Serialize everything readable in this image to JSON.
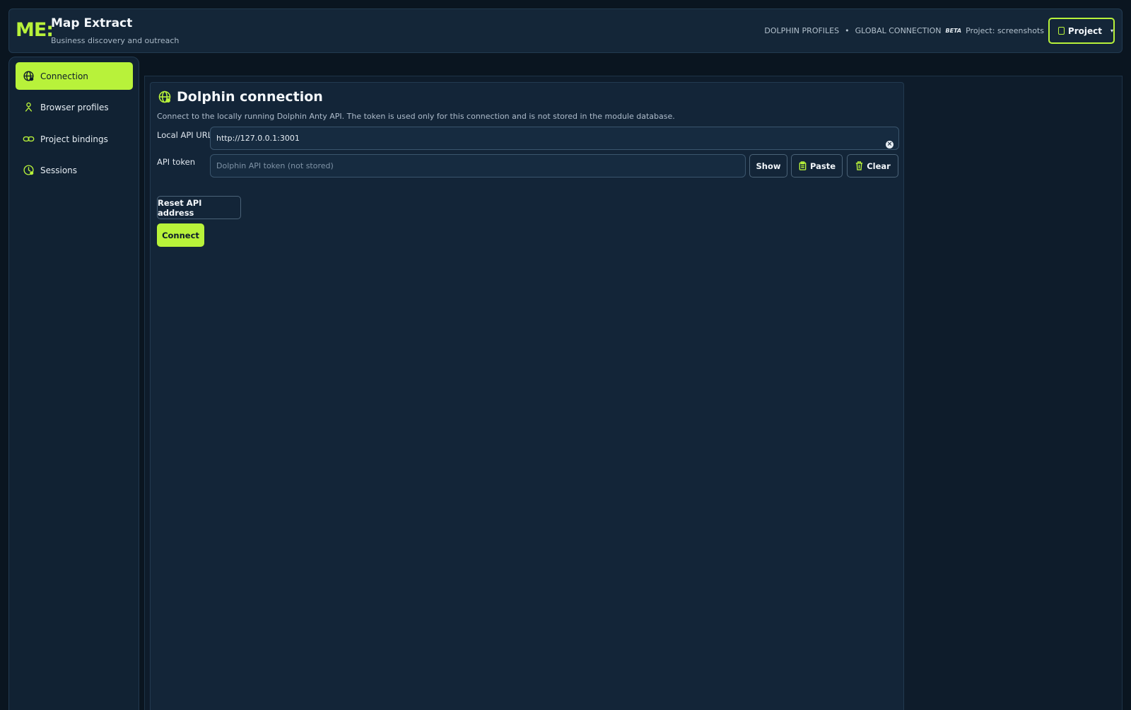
{
  "app": {
    "logo": "ME:",
    "title": "Map Extract",
    "subtitle": "Business discovery and outreach"
  },
  "topbar": {
    "crumb_1": "DOLPHIN PROFILES",
    "separator": "•",
    "crumb_2": "GLOBAL CONNECTION",
    "beta": "BETA",
    "project_label": "Project: screenshots",
    "project_button": "Project"
  },
  "sidebar": {
    "items": [
      {
        "label": "Connection",
        "icon": "globe-icon",
        "active": true
      },
      {
        "label": "Browser profiles",
        "icon": "user-icon",
        "active": false
      },
      {
        "label": "Project bindings",
        "icon": "link-icon",
        "active": false
      },
      {
        "label": "Sessions",
        "icon": "clock-icon",
        "active": false
      }
    ]
  },
  "main": {
    "title": "Dolphin connection",
    "description": "Connect to the locally running Dolphin Anty API. The token is used only for this connection and is not stored in the module database.",
    "api_url_label": "Local API URL",
    "api_url_value": "http://127.0.0.1:3001",
    "token_label": "API token",
    "token_placeholder": "Dolphin API token (not stored)",
    "show_button": "Show",
    "paste_button": "Paste",
    "clear_button": "Clear",
    "reset_button": "Reset API address",
    "connect_button": "Connect"
  },
  "colors": {
    "accent": "#b8f23a",
    "background": "#0a1520",
    "panel": "#132538"
  }
}
